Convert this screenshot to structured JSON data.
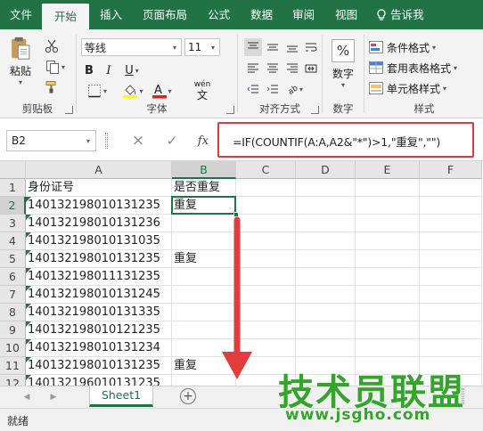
{
  "tabs": [
    "文件",
    "开始",
    "插入",
    "页面布局",
    "公式",
    "数据",
    "审阅",
    "视图"
  ],
  "tell_me": "告诉我",
  "ribbon": {
    "clipboard": {
      "label": "剪贴板",
      "paste": "粘贴"
    },
    "font": {
      "label": "字体",
      "name": "等线",
      "size": "11",
      "wen": "wén"
    },
    "alignment": {
      "label": "对齐方式"
    },
    "number": {
      "label": "数字",
      "button": "数字",
      "percent": "%"
    },
    "styles": {
      "label": "样式",
      "conditional": "条件格式",
      "table": "套用表格格式",
      "cell": "单元格样式"
    }
  },
  "formula_bar": {
    "name_box": "B2",
    "cancel": "×",
    "enter": "✓",
    "fx": "fx",
    "formula": "=IF(COUNTIF(A:A,A2&\"*\")>1,\"重复\",\"\")"
  },
  "columns": [
    "A",
    "B",
    "C",
    "D",
    "E",
    "F"
  ],
  "rows": [
    {
      "num": "1",
      "a": "身份证号",
      "b": "是否重复",
      "tri": false
    },
    {
      "num": "2",
      "a": "140132198010131235",
      "b": "重复",
      "tri": true
    },
    {
      "num": "3",
      "a": "140132198010131236",
      "b": "",
      "tri": true
    },
    {
      "num": "4",
      "a": "140132198010131035",
      "b": "",
      "tri": true
    },
    {
      "num": "5",
      "a": "140132198010131235",
      "b": "重复",
      "tri": true
    },
    {
      "num": "6",
      "a": "140132198011131235",
      "b": "",
      "tri": true
    },
    {
      "num": "7",
      "a": "140132198010131245",
      "b": "",
      "tri": true
    },
    {
      "num": "8",
      "a": "140132198010131335",
      "b": "",
      "tri": true
    },
    {
      "num": "9",
      "a": "140132198010121235",
      "b": "",
      "tri": true
    },
    {
      "num": "10",
      "a": "140132198010131234",
      "b": "",
      "tri": true
    },
    {
      "num": "11",
      "a": "140132198010131235",
      "b": "重复",
      "tri": true
    },
    {
      "num": "12",
      "a": "140132196010131235",
      "b": "",
      "tri": true
    }
  ],
  "sheet_tab": "Sheet1",
  "add_sheet": "+",
  "status": "就绪",
  "watermark": {
    "title": "技术员联盟",
    "url": "www.jsgho.com"
  },
  "colors": {
    "excel_green": "#217346",
    "highlight": "#e03b3b",
    "watermark": "#33a52b"
  }
}
